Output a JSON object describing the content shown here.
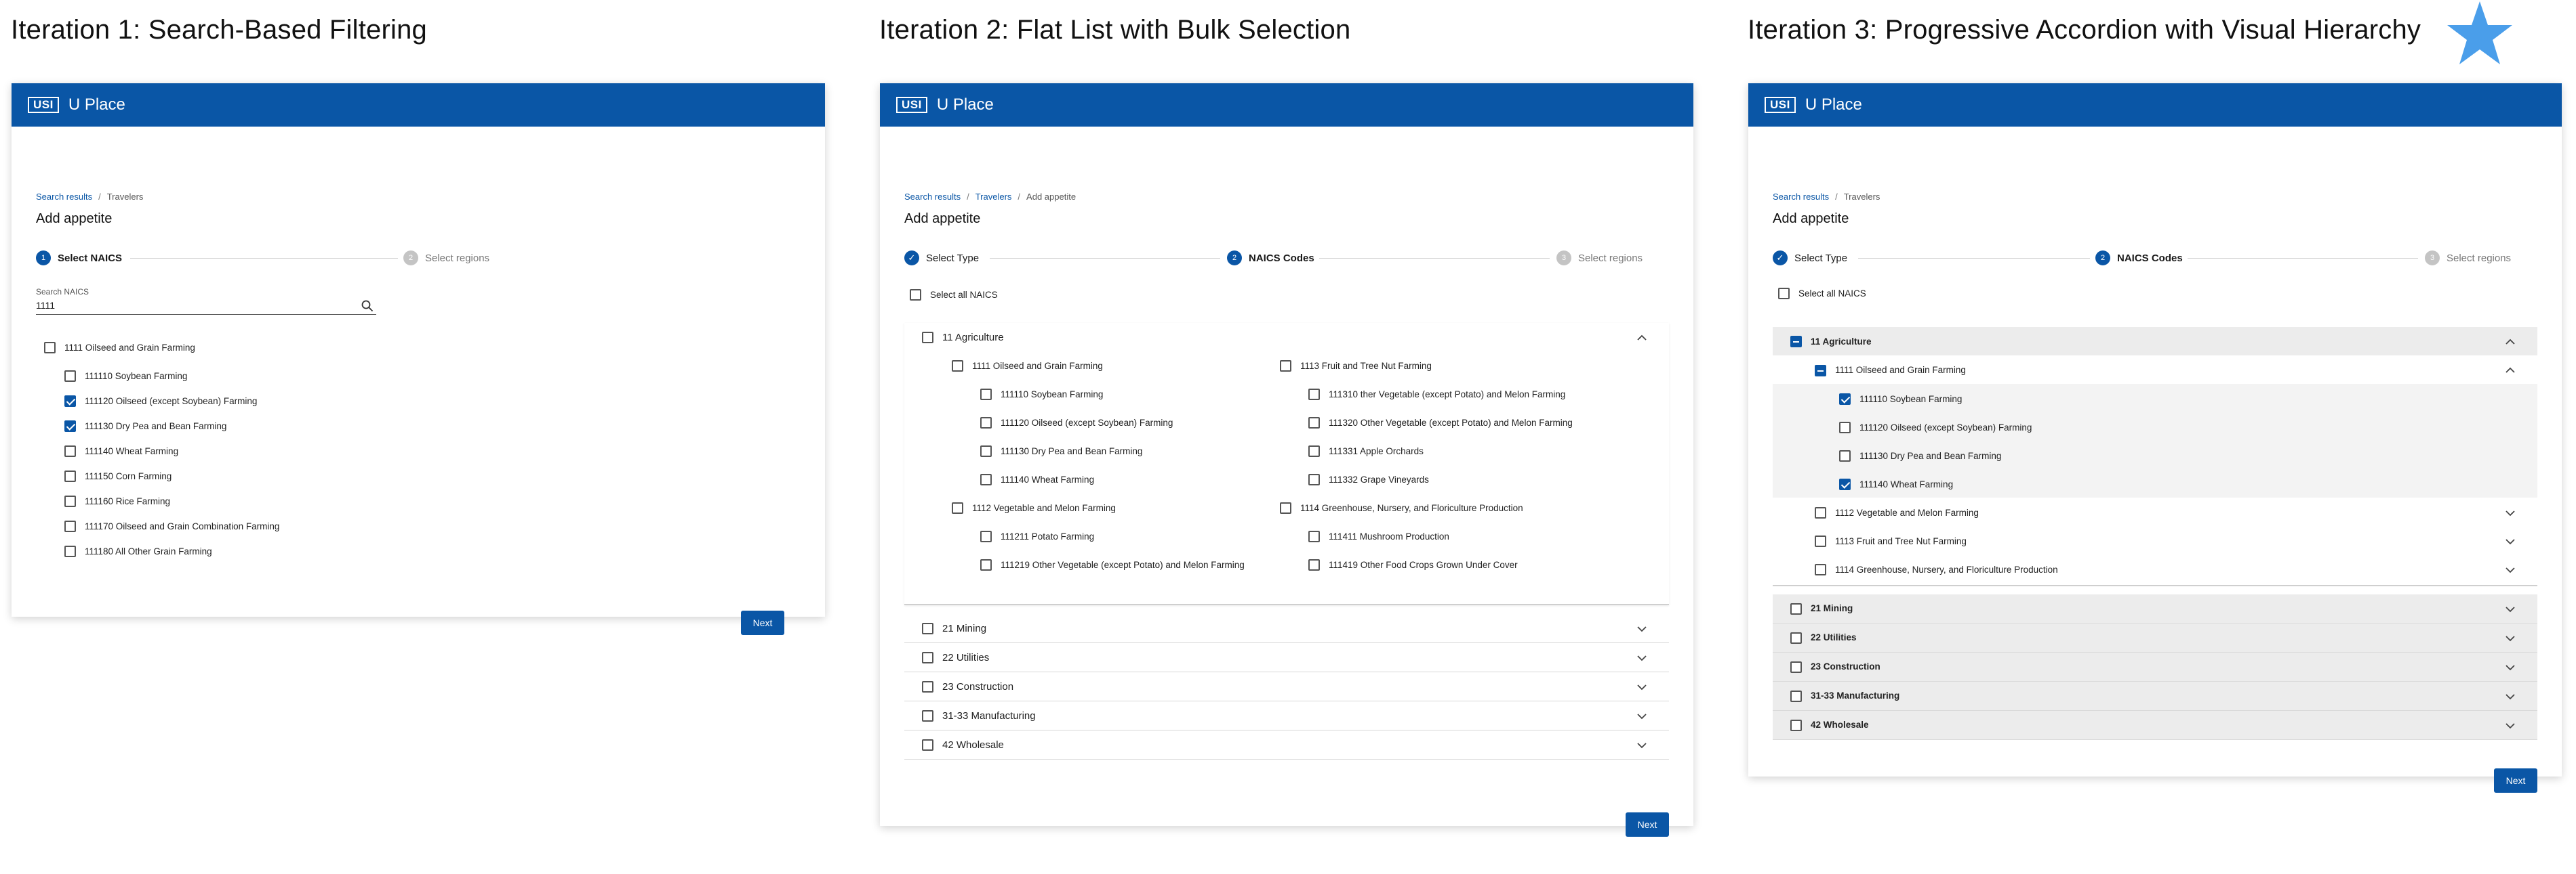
{
  "iterations": [
    {
      "title": "Iteration 1: Search-Based Filtering"
    },
    {
      "title": "Iteration 2: Flat List with Bulk Selection"
    },
    {
      "title": "Iteration 3: Progressive Accordion with Visual Hierarchy"
    }
  ],
  "app": {
    "logo": "USI",
    "name": "U Place"
  },
  "colors": {
    "brand": "#0a56a6",
    "star": "#4a9eea",
    "section_bg": "#ececec",
    "expanded_bg": "#f3f3f3"
  },
  "icons": {
    "search": "search-icon",
    "chevron_up": "chevron-up-icon",
    "chevron_down": "chevron-down-icon",
    "check": "check-icon",
    "star": "star-icon"
  },
  "page_title": "Add appetite",
  "next_label": "Next",
  "f1": {
    "breadcrumb": [
      "Search results",
      "Travelers"
    ],
    "steps": [
      {
        "num": "1",
        "label": "Select NAICS"
      },
      {
        "num": "2",
        "label": "Select regions"
      }
    ],
    "search_label": "Search NAICS",
    "search_value": "1111",
    "group": {
      "label": "1111 Oilseed and Grain Farming",
      "checked": false
    },
    "items": [
      {
        "label": "111110 Soybean Farming",
        "checked": false
      },
      {
        "label": "111120 Oilseed (except Soybean) Farming",
        "checked": true
      },
      {
        "label": "111130 Dry Pea and Bean Farming",
        "checked": true
      },
      {
        "label": "111140 Wheat Farming",
        "checked": false
      },
      {
        "label": "111150 Corn Farming",
        "checked": false
      },
      {
        "label": "111160 Rice Farming",
        "checked": false
      },
      {
        "label": "111170 Oilseed and Grain Combination Farming",
        "checked": false
      },
      {
        "label": "111180 All Other Grain Farming",
        "checked": false
      }
    ]
  },
  "f2": {
    "breadcrumb": [
      "Search results",
      "Travelers",
      "Add appetite"
    ],
    "steps": [
      {
        "num": "✓",
        "label": "Select Type"
      },
      {
        "num": "2",
        "label": "NAICS Codes"
      },
      {
        "num": "3",
        "label": "Select regions"
      }
    ],
    "select_all": "Select all NAICS",
    "agriculture": "11 Agriculture",
    "col_left": [
      {
        "label": "1111 Oilseed and Grain Farming",
        "items": [
          "111110 Soybean Farming",
          "111120 Oilseed (except Soybean) Farming",
          "111130 Dry Pea and Bean Farming",
          "111140 Wheat Farming"
        ]
      },
      {
        "label": "1112 Vegetable and Melon Farming",
        "items": [
          "111211 Potato Farming",
          "111219 Other Vegetable (except Potato) and Melon Farming"
        ]
      }
    ],
    "col_right": [
      {
        "label": "1113 Fruit and Tree Nut Farming",
        "items": [
          "111310 ther Vegetable (except Potato) and Melon Farming",
          "111320 Other Vegetable (except Potato) and Melon Farming",
          "111331 Apple Orchards",
          "111332 Grape Vineyards"
        ]
      },
      {
        "label": "1114 Greenhouse, Nursery, and Floriculture Production",
        "items": [
          "111411 Mushroom Production",
          "111419 Other Food Crops Grown Under Cover"
        ]
      }
    ],
    "sectors": [
      "21 Mining",
      "22 Utilities",
      "23 Construction",
      "31-33 Manufacturing",
      "42 Wholesale"
    ]
  },
  "f3": {
    "breadcrumb": [
      "Search results",
      "Travelers"
    ],
    "steps": [
      {
        "num": "✓",
        "label": "Select Type"
      },
      {
        "num": "2",
        "label": "NAICS Codes"
      },
      {
        "num": "3",
        "label": "Select regions"
      }
    ],
    "select_all": "Select all NAICS",
    "agriculture": "11 Agriculture",
    "expanded_group": "1111 Oilseed and Grain Farming",
    "items": [
      {
        "label": "111110 Soybean Farming",
        "checked": true
      },
      {
        "label": "111120 Oilseed (except Soybean) Farming",
        "checked": false
      },
      {
        "label": "111130 Dry Pea and Bean Farming",
        "checked": false
      },
      {
        "label": "111140 Wheat Farming",
        "checked": true
      }
    ],
    "collapsed_groups": [
      "1112 Vegetable and Melon Farming",
      "1113 Fruit and Tree Nut Farming",
      "1114 Greenhouse, Nursery, and Floriculture Production"
    ],
    "sectors": [
      "21 Mining",
      "22 Utilities",
      "23 Construction",
      "31-33 Manufacturing",
      "42 Wholesale"
    ]
  }
}
